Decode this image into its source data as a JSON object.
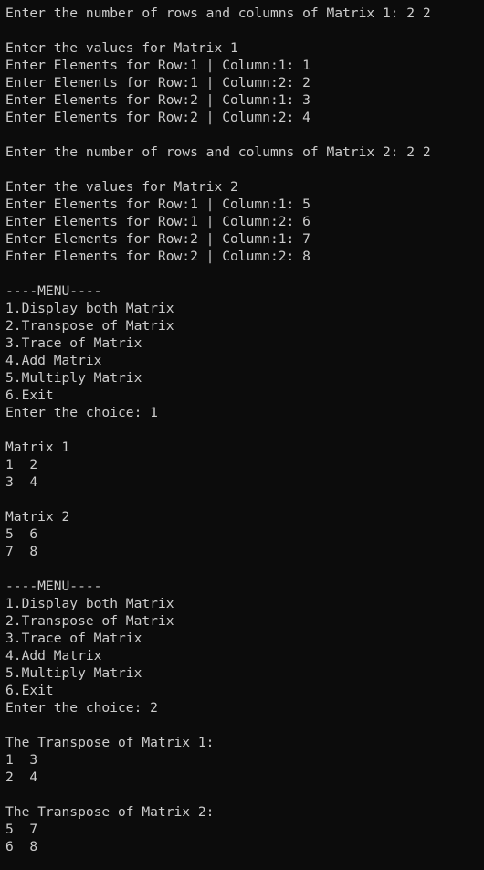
{
  "terminal": {
    "lines": [
      "Enter the number of rows and columns of Matrix 1: 2 2",
      "",
      "Enter the values for Matrix 1",
      "Enter Elements for Row:1 | Column:1: 1",
      "Enter Elements for Row:1 | Column:2: 2",
      "Enter Elements for Row:2 | Column:1: 3",
      "Enter Elements for Row:2 | Column:2: 4",
      "",
      "Enter the number of rows and columns of Matrix 2: 2 2",
      "",
      "Enter the values for Matrix 2",
      "Enter Elements for Row:1 | Column:1: 5",
      "Enter Elements for Row:1 | Column:2: 6",
      "Enter Elements for Row:2 | Column:1: 7",
      "Enter Elements for Row:2 | Column:2: 8",
      "",
      "----MENU----",
      "1.Display both Matrix",
      "2.Transpose of Matrix",
      "3.Trace of Matrix",
      "4.Add Matrix",
      "5.Multiply Matrix",
      "6.Exit",
      "Enter the choice: 1",
      "",
      "Matrix 1",
      "1  2",
      "3  4",
      "",
      "Matrix 2",
      "5  6",
      "7  8",
      "",
      "----MENU----",
      "1.Display both Matrix",
      "2.Transpose of Matrix",
      "3.Trace of Matrix",
      "4.Add Matrix",
      "5.Multiply Matrix",
      "6.Exit",
      "Enter the choice: 2",
      "",
      "The Transpose of Matrix 1:",
      "1  3",
      "2  4",
      "",
      "The Transpose of Matrix 2:",
      "5  7",
      "6  8"
    ]
  },
  "colors": {
    "background": "#0c0c0c",
    "text": "#cccccc"
  }
}
